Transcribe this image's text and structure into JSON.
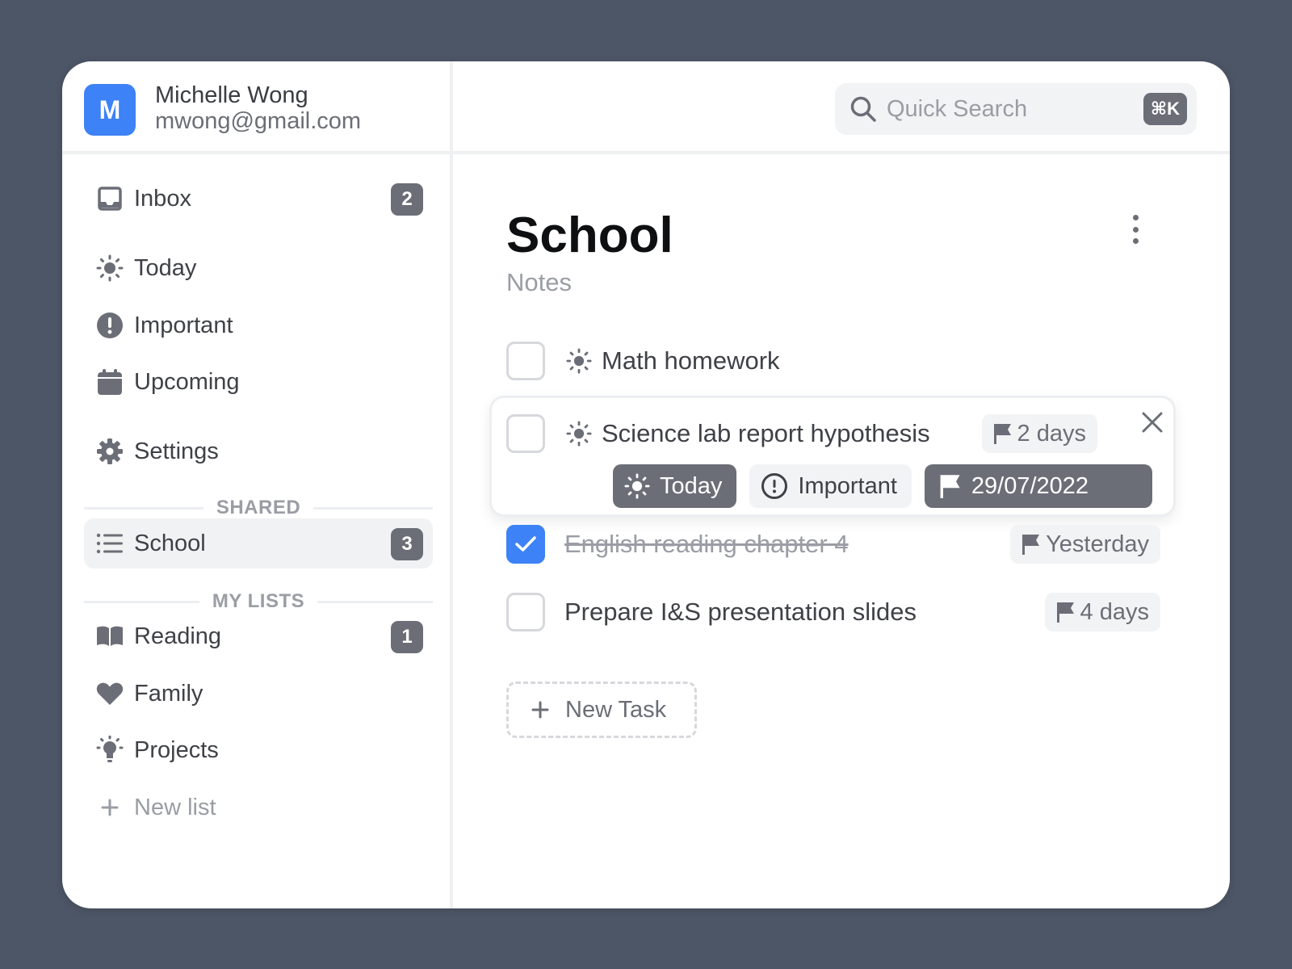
{
  "colors": {
    "accent": "#3d82f6",
    "badge": "#6b6e76",
    "background": "#4d5666"
  },
  "user": {
    "initial": "M",
    "name": "Michelle Wong",
    "email": "mwong@gmail.com"
  },
  "nav": {
    "inbox": {
      "label": "Inbox",
      "count": "2",
      "icon": "inbox-icon"
    },
    "today": {
      "label": "Today",
      "icon": "sun-icon"
    },
    "important": {
      "label": "Important",
      "icon": "exclamation-circle-icon"
    },
    "upcoming": {
      "label": "Upcoming",
      "icon": "calendar-icon"
    },
    "settings": {
      "label": "Settings",
      "icon": "gear-icon"
    }
  },
  "sections": {
    "shared": "SHARED",
    "my_lists": "MY LISTS"
  },
  "lists": {
    "school": {
      "label": "School",
      "count": "3",
      "icon": "list-icon"
    },
    "reading": {
      "label": "Reading",
      "count": "1",
      "icon": "book-icon"
    },
    "family": {
      "label": "Family",
      "icon": "heart-icon"
    },
    "projects": {
      "label": "Projects",
      "icon": "lightbulb-icon"
    },
    "new_list": {
      "label": "New list",
      "icon": "plus-icon"
    }
  },
  "search": {
    "placeholder": "Quick Search",
    "shortcut": "⌘K"
  },
  "page": {
    "title": "School",
    "subtitle": "Notes"
  },
  "tasks": [
    {
      "label": "Math homework",
      "checked": false,
      "icon": "sun-icon"
    },
    {
      "label": "Science lab report hypothesis",
      "checked": false,
      "icon": "sun-icon",
      "due": "2 days",
      "expanded": true,
      "chips": {
        "today": "Today",
        "important": "Important",
        "date": "29/07/2022"
      }
    },
    {
      "label": "English reading chapter 4",
      "checked": true,
      "due": "Yesterday"
    },
    {
      "label": "Prepare I&S presentation slides",
      "checked": false,
      "due": "4 days"
    }
  ],
  "new_task": {
    "label": "New Task"
  }
}
